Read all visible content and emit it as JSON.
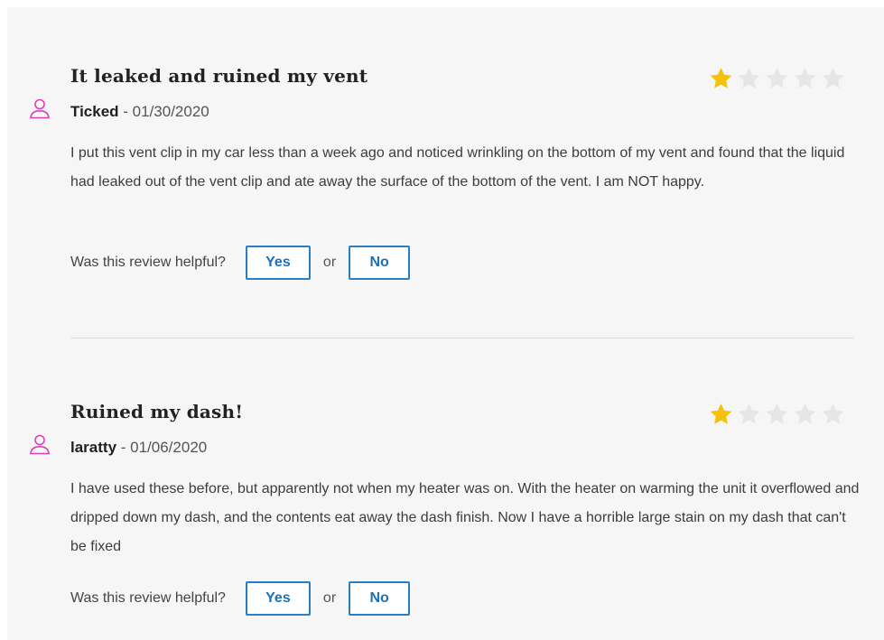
{
  "colors": {
    "panel_bg": "#f6f6f6",
    "star_filled": "#f4c20d",
    "star_empty": "#e6e6e6",
    "avatar_pink": "#e040b8",
    "button_blue": "#2a7fc4"
  },
  "icons": {
    "avatar": "user-outline-icon",
    "star": "star-icon"
  },
  "reviews": [
    {
      "title": "It leaked and ruined my vent",
      "author": "Ticked",
      "date": " - 01/30/2020",
      "rating": 1,
      "max_rating": 5,
      "text": "I put this vent clip in my car less than a week ago and noticed wrinkling on the bottom of my vent and found that the liquid had leaked out of the vent clip and ate away the surface of the bottom of the vent. I am NOT happy.",
      "helpful_label": "Was this review helpful?",
      "yes_label": "Yes",
      "or_label": "or",
      "no_label": "No"
    },
    {
      "title": "Ruined my dash!",
      "author": "laratty",
      "date": " - 01/06/2020",
      "rating": 1,
      "max_rating": 5,
      "text": "I have used these before, but apparently not when my heater was on. With the heater on warming the unit it overflowed and dripped down my dash, and the contents eat away the dash finish. Now I have a horrible large stain on my dash that can't be fixed",
      "helpful_label": "Was this review helpful?",
      "yes_label": "Yes",
      "or_label": "or",
      "no_label": "No"
    }
  ]
}
